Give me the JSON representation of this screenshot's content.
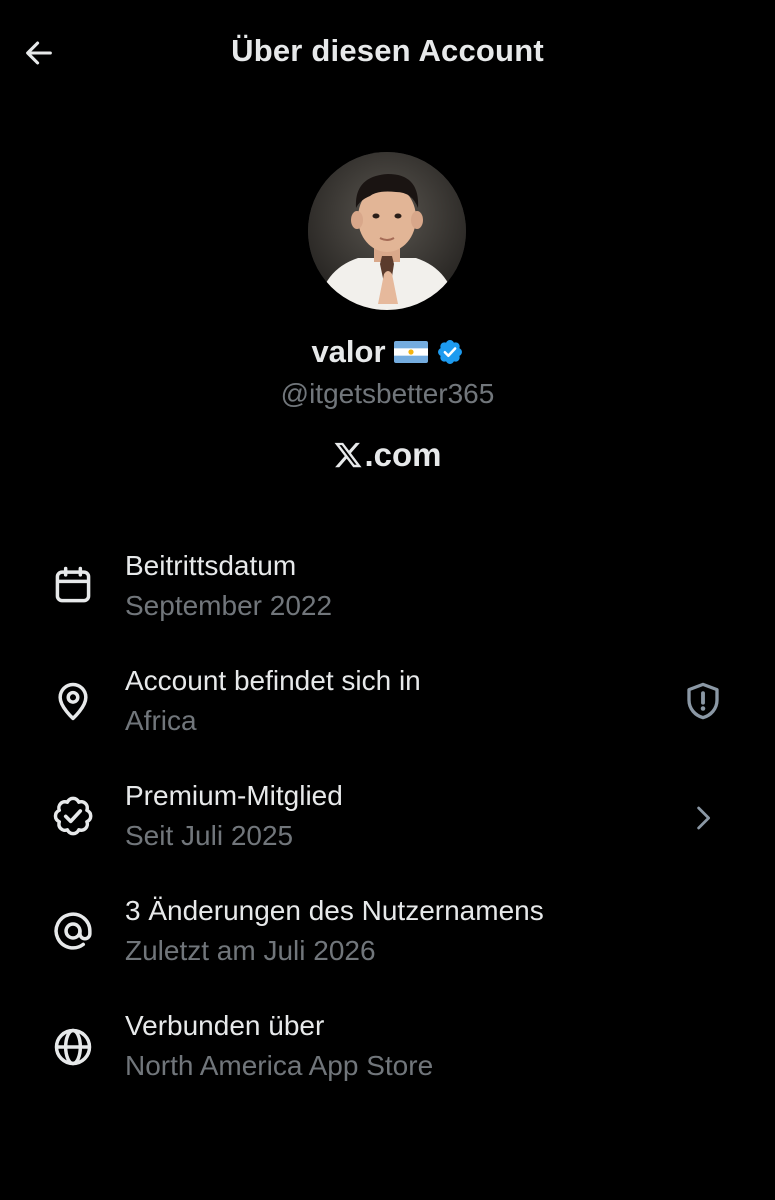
{
  "header": {
    "title": "Über diesen Account",
    "back_icon": "arrow-left-icon"
  },
  "profile": {
    "avatar_description": "profile-photo",
    "display_name": "valor",
    "flag_icon": "argentina-flag-icon",
    "verified_icon": "verified-badge-icon",
    "handle": "@itgetsbetter365",
    "site_text": ".com",
    "site_logo_icon": "x-logo-icon"
  },
  "rows": [
    {
      "icon": "calendar-icon",
      "label": "Beitrittsdatum",
      "value": "September 2022"
    },
    {
      "icon": "location-pin-icon",
      "label": "Account befindet sich in",
      "value": "Africa",
      "right_icon": "shield-alert-icon"
    },
    {
      "icon": "verified-seal-icon",
      "label": "Premium-Mitglied",
      "value": "Seit Juli 2025",
      "right_icon": "chevron-right-icon"
    },
    {
      "icon": "at-sign-icon",
      "label": "3 Änderungen des Nutzernamens",
      "value": "Zuletzt am Juli 2026"
    },
    {
      "icon": "globe-icon",
      "label": "Verbunden über",
      "value": "North America App Store"
    }
  ],
  "colors": {
    "background": "#000000",
    "primary_text": "#e7e9ea",
    "secondary_text": "#71767b",
    "verified_blue": "#1d9bf0"
  }
}
